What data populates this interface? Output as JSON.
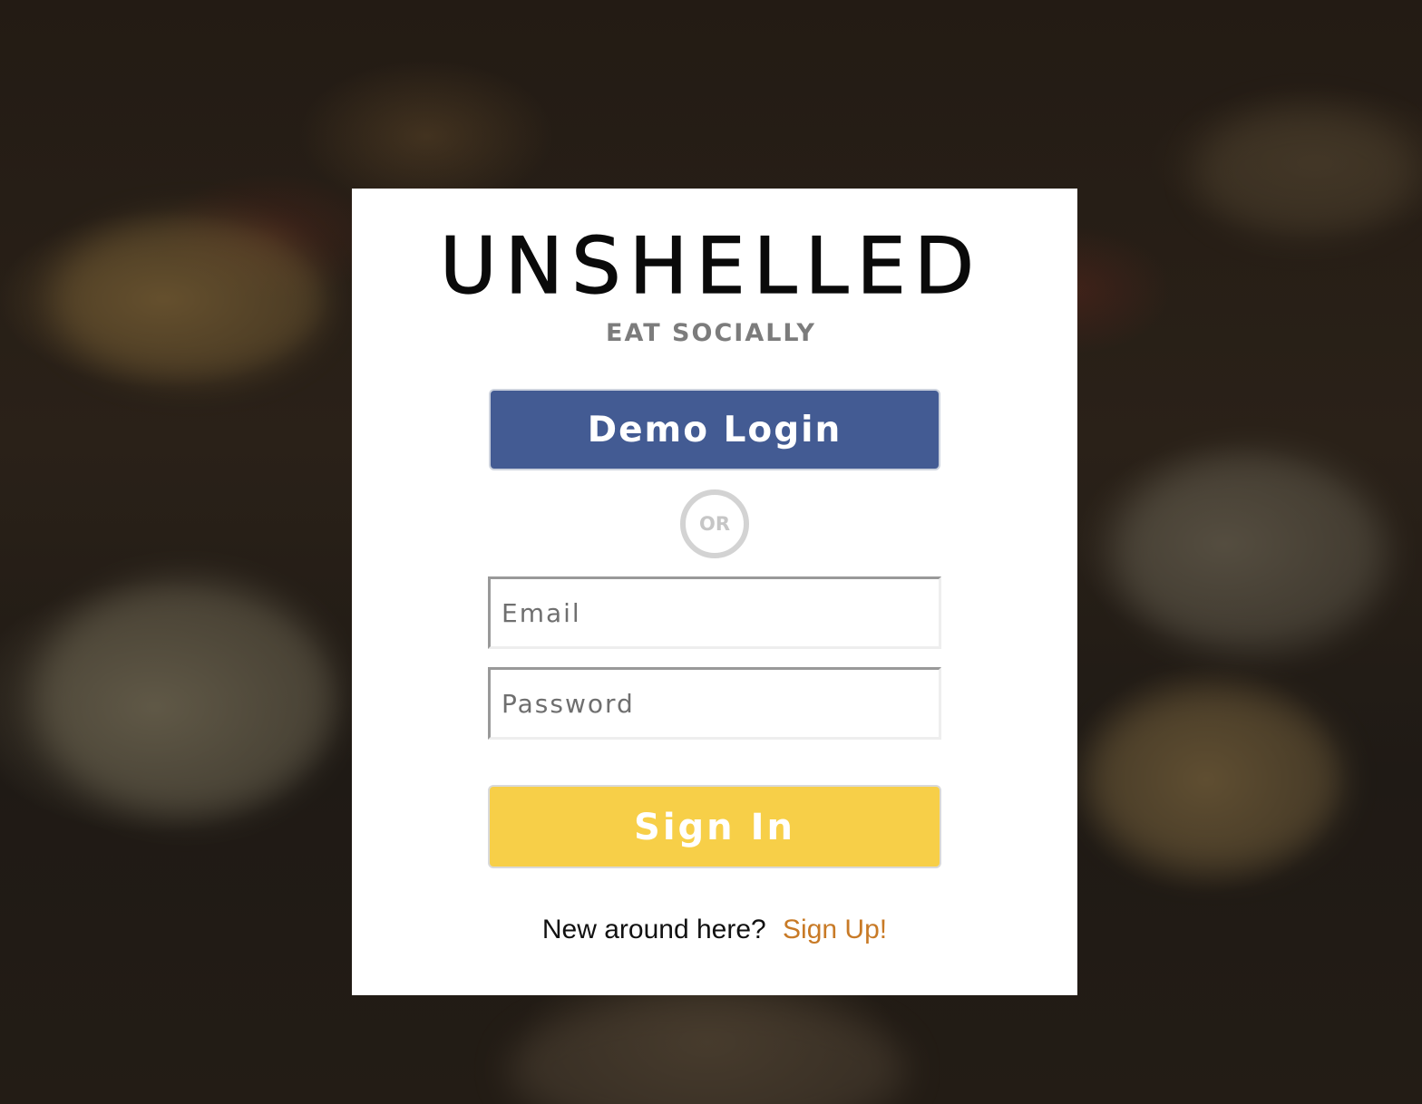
{
  "brand": {
    "name": "UNSHELLED",
    "tagline": "EAT SOCIALLY"
  },
  "login": {
    "demo_label": "Demo Login",
    "divider_label": "OR",
    "email_placeholder": "Email",
    "password_placeholder": "Password",
    "signin_label": "Sign In",
    "signup_prompt": "New around here?",
    "signup_link": "Sign Up!"
  },
  "colors": {
    "demo_button": "#435b93",
    "signin_button": "#f7cf48",
    "signup_link": "#c87a26"
  },
  "icons": {
    "background": "food-photo-background"
  }
}
